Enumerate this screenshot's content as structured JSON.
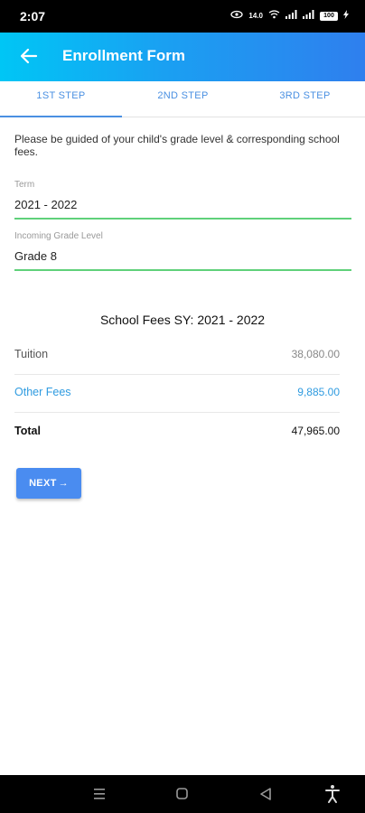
{
  "status": {
    "time": "2:07",
    "speed": "14.0",
    "battery": "100"
  },
  "header": {
    "title": "Enrollment Form",
    "back_icon": "arrow-left-icon"
  },
  "tabs": [
    {
      "label": "1ST STEP",
      "active": true
    },
    {
      "label": "2ND STEP",
      "active": false
    },
    {
      "label": "3RD STEP",
      "active": false
    }
  ],
  "form": {
    "intro": "Please be guided of your child's grade level & corresponding school fees.",
    "term": {
      "label": "Term",
      "value": "2021 - 2022"
    },
    "grade": {
      "label": "Incoming Grade Level",
      "value": "Grade 8"
    }
  },
  "fees": {
    "title": "School Fees SY: 2021 - 2022",
    "rows": [
      {
        "label": "Tuition",
        "amount": "38,080.00"
      },
      {
        "label": "Other Fees",
        "amount": "9,885.00"
      },
      {
        "label": "Total",
        "amount": "47,965.00"
      }
    ]
  },
  "actions": {
    "next_label": "NEXT",
    "next_arrow": "→"
  },
  "colors": {
    "accent": "#4a90e2",
    "underline": "#5fd17a",
    "link": "#2f9be0"
  },
  "nav": {
    "icons": [
      "menu-icon",
      "home-icon",
      "back-triangle-icon",
      "accessibility-icon"
    ]
  }
}
